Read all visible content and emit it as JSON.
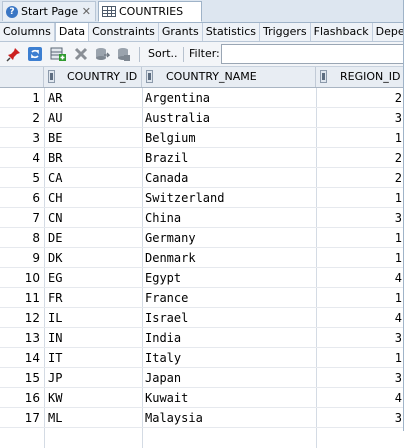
{
  "tabs": [
    {
      "label": "Start Page",
      "icon": "help-icon"
    },
    {
      "label": "COUNTRIES",
      "icon": "table-icon"
    }
  ],
  "close_glyph": "✕",
  "subtabs": [
    "Columns",
    "Data",
    "Constraints",
    "Grants",
    "Statistics",
    "Triggers",
    "Flashback",
    "Depe"
  ],
  "active_subtab": "Data",
  "toolbar": {
    "icons": [
      "pin-icon",
      "refresh-icon",
      "insert-row-icon",
      "delete-row-icon",
      "commit-icon",
      "rollback-icon"
    ],
    "sort_label": "Sort..",
    "filter_label": "Filter:",
    "filter_value": ""
  },
  "grid": {
    "columns": [
      "COUNTRY_ID",
      "COUNTRY_NAME",
      "REGION_ID"
    ],
    "rows": [
      {
        "n": "1",
        "id": "AR",
        "name": "Argentina",
        "region": "2"
      },
      {
        "n": "2",
        "id": "AU",
        "name": "Australia",
        "region": "3"
      },
      {
        "n": "3",
        "id": "BE",
        "name": "Belgium",
        "region": "1"
      },
      {
        "n": "4",
        "id": "BR",
        "name": "Brazil",
        "region": "2"
      },
      {
        "n": "5",
        "id": "CA",
        "name": "Canada",
        "region": "2"
      },
      {
        "n": "6",
        "id": "CH",
        "name": "Switzerland",
        "region": "1"
      },
      {
        "n": "7",
        "id": "CN",
        "name": "China",
        "region": "3"
      },
      {
        "n": "8",
        "id": "DE",
        "name": "Germany",
        "region": "1"
      },
      {
        "n": "9",
        "id": "DK",
        "name": "Denmark",
        "region": "1"
      },
      {
        "n": "10",
        "id": "EG",
        "name": "Egypt",
        "region": "4"
      },
      {
        "n": "11",
        "id": "FR",
        "name": "France",
        "region": "1"
      },
      {
        "n": "12",
        "id": "IL",
        "name": "Israel",
        "region": "4"
      },
      {
        "n": "13",
        "id": "IN",
        "name": "India",
        "region": "3"
      },
      {
        "n": "14",
        "id": "IT",
        "name": "Italy",
        "region": "1"
      },
      {
        "n": "15",
        "id": "JP",
        "name": "Japan",
        "region": "3"
      },
      {
        "n": "16",
        "id": "KW",
        "name": "Kuwait",
        "region": "4"
      },
      {
        "n": "17",
        "id": "ML",
        "name": "Malaysia",
        "region": "3"
      }
    ]
  }
}
